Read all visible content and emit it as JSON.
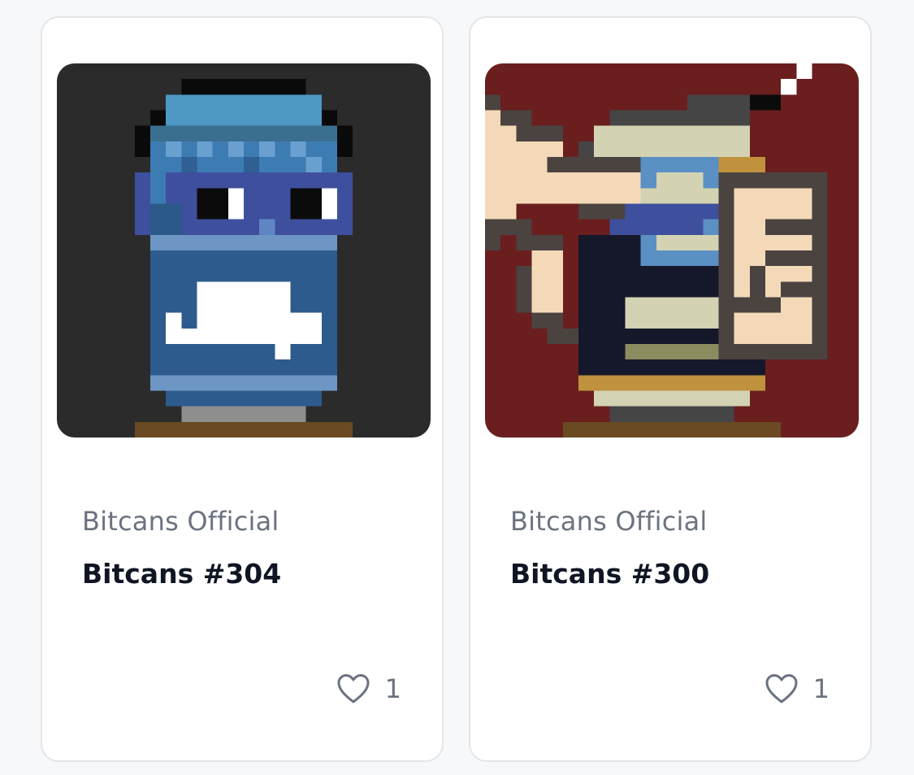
{
  "cards": [
    {
      "collection": "Bitcans Official",
      "title": "Bitcans #304",
      "likes": "1",
      "image": "pixel-art-blue-can-with-glasses",
      "background_color": "#2b2b2b"
    },
    {
      "collection": "Bitcans Official",
      "title": "Bitcans #300",
      "likes": "1",
      "image": "pixel-art-can-held-by-hands",
      "background_color": "#6a1e1e"
    }
  ],
  "icons": {
    "like": "heart-outline-icon"
  },
  "colors": {
    "text_muted": "#6b7280",
    "text_strong": "#0f1523",
    "card_border": "#e3e5e8"
  }
}
